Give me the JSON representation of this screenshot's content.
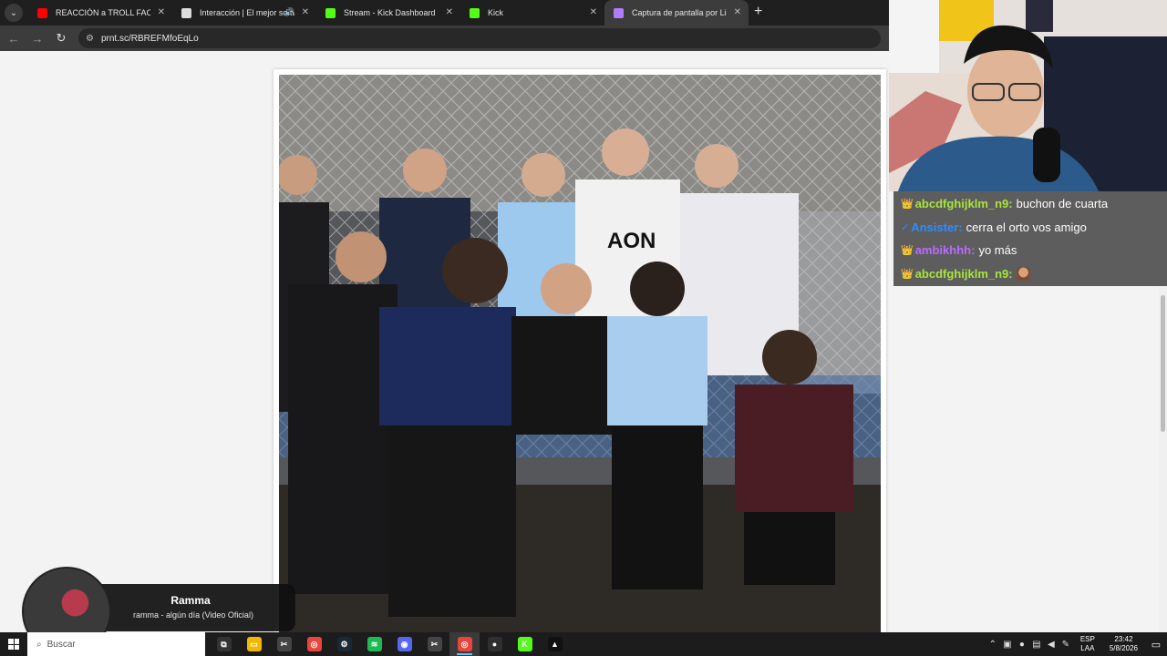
{
  "browser": {
    "tabs": [
      {
        "label": "REACCIÓN a TROLL FACE REMIX",
        "favicon": "youtube-icon",
        "color": "#ff0000",
        "audio": false,
        "active": false
      },
      {
        "label": "Interacción | El mejor software",
        "favicon": "interaction-icon",
        "color": "#dddddd",
        "audio": true,
        "active": false
      },
      {
        "label": "Stream - Kick Dashboard",
        "favicon": "kick-icon",
        "color": "#53fc18",
        "audio": false,
        "active": false
      },
      {
        "label": "Kick",
        "favicon": "kick-icon",
        "color": "#53fc18",
        "audio": false,
        "active": false
      },
      {
        "label": "Captura de pantalla por Lightshot",
        "favicon": "lightshot-icon",
        "color": "#b37cff",
        "audio": false,
        "active": true
      }
    ],
    "new_tab_glyph": "+",
    "url": "prnt.sc/RBREFMfoEqLo"
  },
  "chat": {
    "messages": [
      {
        "badge": "👑",
        "user": "abcdfghijklm_n9:",
        "user_color": "#a8e63a",
        "text": "buchon de cuarta",
        "emote": false
      },
      {
        "badge": "✓",
        "user": "Ansister:",
        "user_color": "#2f8cff",
        "text": "cerra el orto vos amigo",
        "emote": false
      },
      {
        "badge": "👑",
        "user": "ambikhhh:",
        "user_color": "#b96bff",
        "text": "yo más",
        "emote": false
      },
      {
        "badge": "👑",
        "user": "abcdfghijklm_n9:",
        "user_color": "#a8e63a",
        "text": "",
        "emote": true
      }
    ]
  },
  "now_playing": {
    "artist": "Ramma",
    "track": "ramma - algún día (Video Oficial)"
  },
  "taskbar": {
    "search_placeholder": "Buscar",
    "apps": [
      {
        "name": "task-view-icon",
        "glyph": "⧉",
        "color": "#333333",
        "active": false
      },
      {
        "name": "file-explorer-icon",
        "glyph": "▭",
        "color": "#f2b705",
        "active": false
      },
      {
        "name": "capcut-icon",
        "glyph": "✂",
        "color": "#444444",
        "active": false
      },
      {
        "name": "chrome-icon",
        "glyph": "◎",
        "color": "#e8453c",
        "active": false
      },
      {
        "name": "steam-icon",
        "glyph": "⚙",
        "color": "#1b2838",
        "active": false
      },
      {
        "name": "spotify-icon",
        "glyph": "≋",
        "color": "#1db954",
        "active": false
      },
      {
        "name": "discord-icon",
        "glyph": "◉",
        "color": "#5865f2",
        "active": false
      },
      {
        "name": "capcut-icon-2",
        "glyph": "✂",
        "color": "#444444",
        "active": false
      },
      {
        "name": "chrome-icon-2",
        "glyph": "◎",
        "color": "#e8453c",
        "active": true
      },
      {
        "name": "obs-icon",
        "glyph": "●",
        "color": "#302e31",
        "active": false
      },
      {
        "name": "kick-icon",
        "glyph": "K",
        "color": "#53fc18",
        "active": false
      },
      {
        "name": "game-icon",
        "glyph": "▲",
        "color": "#111111",
        "active": false
      }
    ],
    "lang_top": "ESP",
    "lang_bottom": "LAA",
    "time": "23:42",
    "date": "5/8/2026"
  }
}
